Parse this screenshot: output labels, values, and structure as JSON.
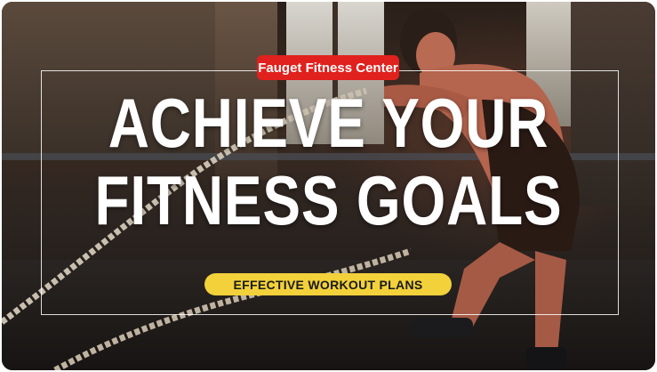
{
  "brand": {
    "label": "Fauget Fitness Center"
  },
  "headline": {
    "line1": "ACHIEVE YOUR",
    "line2": "FITNESS GOALS"
  },
  "cta": {
    "label": "EFFECTIVE WORKOUT PLANS"
  },
  "colors": {
    "brand_bg": "#e0211d",
    "cta_bg": "#f2d13b",
    "text": "#ffffff"
  }
}
